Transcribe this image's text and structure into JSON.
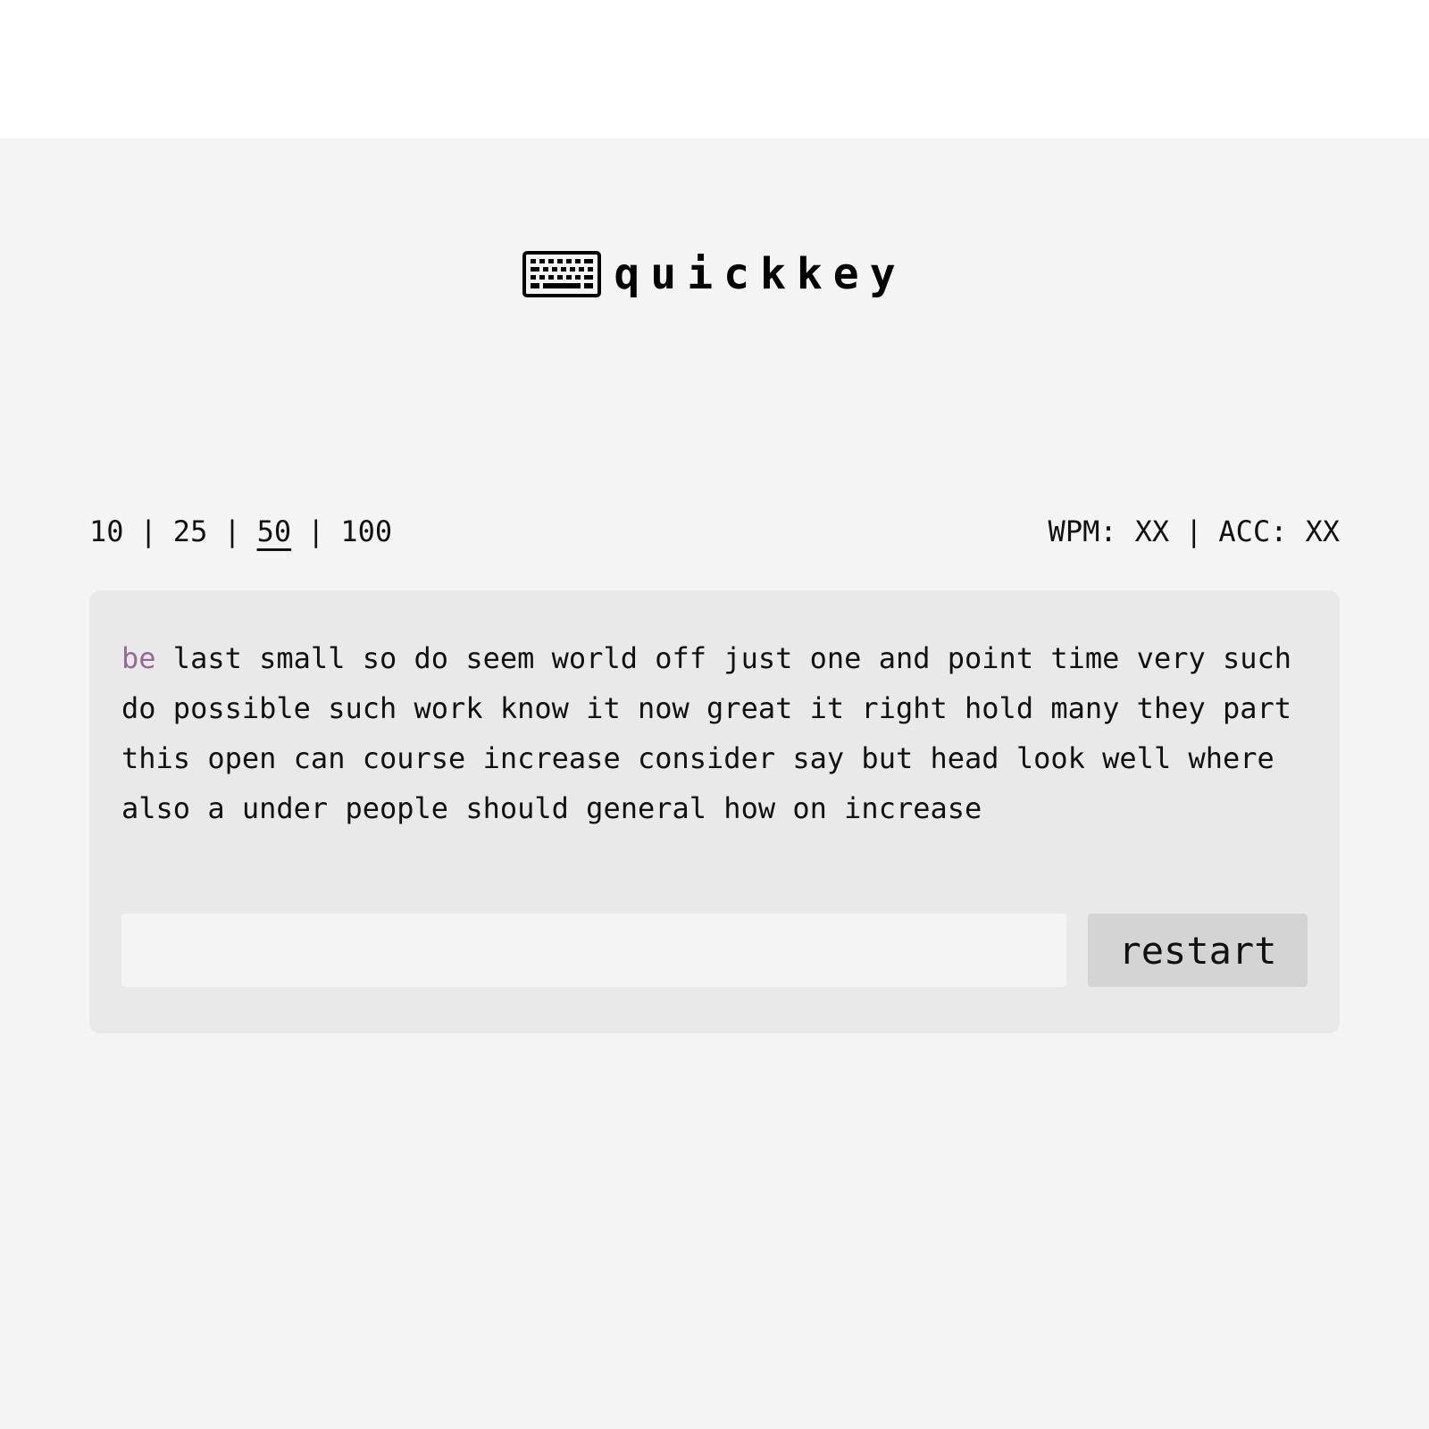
{
  "app": {
    "title": "quickkey",
    "logo_icon": "keyboard-icon"
  },
  "word_counts": {
    "options": [
      "10",
      "25",
      "50",
      "100"
    ],
    "separator": "|",
    "selected": "50"
  },
  "stats": {
    "wpm_label": "WPM:",
    "wpm_value": "XX",
    "separator": "|",
    "acc_label": "ACC:",
    "acc_value": "XX"
  },
  "test": {
    "current_index": 0,
    "words": [
      "be",
      "last",
      "small",
      "so",
      "do",
      "seem",
      "world",
      "off",
      "just",
      "one",
      "and",
      "point",
      "time",
      "very",
      "such",
      "do",
      "possible",
      "such",
      "work",
      "know",
      "it",
      "now",
      "great",
      "it",
      "right",
      "hold",
      "many",
      "they",
      "part",
      "this",
      "open",
      "can",
      "course",
      "increase",
      "consider",
      "say",
      "but",
      "head",
      "look",
      "well",
      "where",
      "also",
      "a",
      "under",
      "people",
      "should",
      "general",
      "how",
      "on",
      "increase"
    ],
    "input_value": "",
    "restart_label": "restart"
  },
  "colors": {
    "page_background": "#f4f4f4",
    "card_background": "#e9e9e9",
    "current_word": "#956b94",
    "button_background": "#d4d4d4"
  }
}
